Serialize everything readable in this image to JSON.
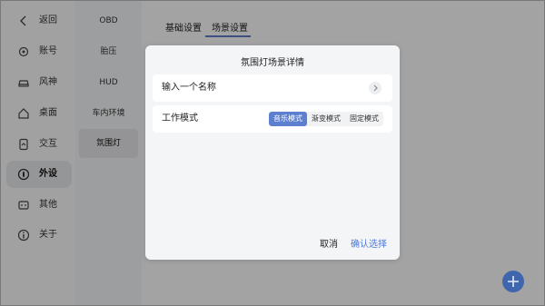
{
  "colors": {
    "accent": "#5d7fcf",
    "confirm_text": "#4d79d6",
    "fab": "#3f66ad",
    "overlay": "rgba(0,0,0,0.35)"
  },
  "nav": {
    "items": [
      {
        "label": "返回",
        "icon": "back-chevron-icon"
      },
      {
        "label": "账号",
        "icon": "account-icon"
      },
      {
        "label": "风神",
        "icon": "car-icon"
      },
      {
        "label": "桌面",
        "icon": "home-icon"
      },
      {
        "label": "交互",
        "icon": "interaction-icon"
      },
      {
        "label": "外设",
        "icon": "peripheral-icon",
        "active": true
      },
      {
        "label": "其他",
        "icon": "other-icon"
      },
      {
        "label": "关于",
        "icon": "info-icon"
      }
    ]
  },
  "subnav": {
    "items": [
      {
        "label": "OBD"
      },
      {
        "label": "胎压"
      },
      {
        "label": "HUD"
      },
      {
        "label": "车内环境"
      },
      {
        "label": "氛围灯",
        "active": true
      }
    ]
  },
  "tabs": [
    {
      "label": "基础设置"
    },
    {
      "label": "场景设置",
      "active": true
    }
  ],
  "dialog": {
    "title": "氛围灯场景详情",
    "name_row_label": "输入一个名称",
    "mode_row_label": "工作模式",
    "modes": [
      {
        "label": "音乐模式",
        "active": true
      },
      {
        "label": "渐变模式"
      },
      {
        "label": "固定模式"
      }
    ],
    "cancel_label": "取消",
    "confirm_label": "确认选择"
  },
  "fab_icon": "plus-icon"
}
